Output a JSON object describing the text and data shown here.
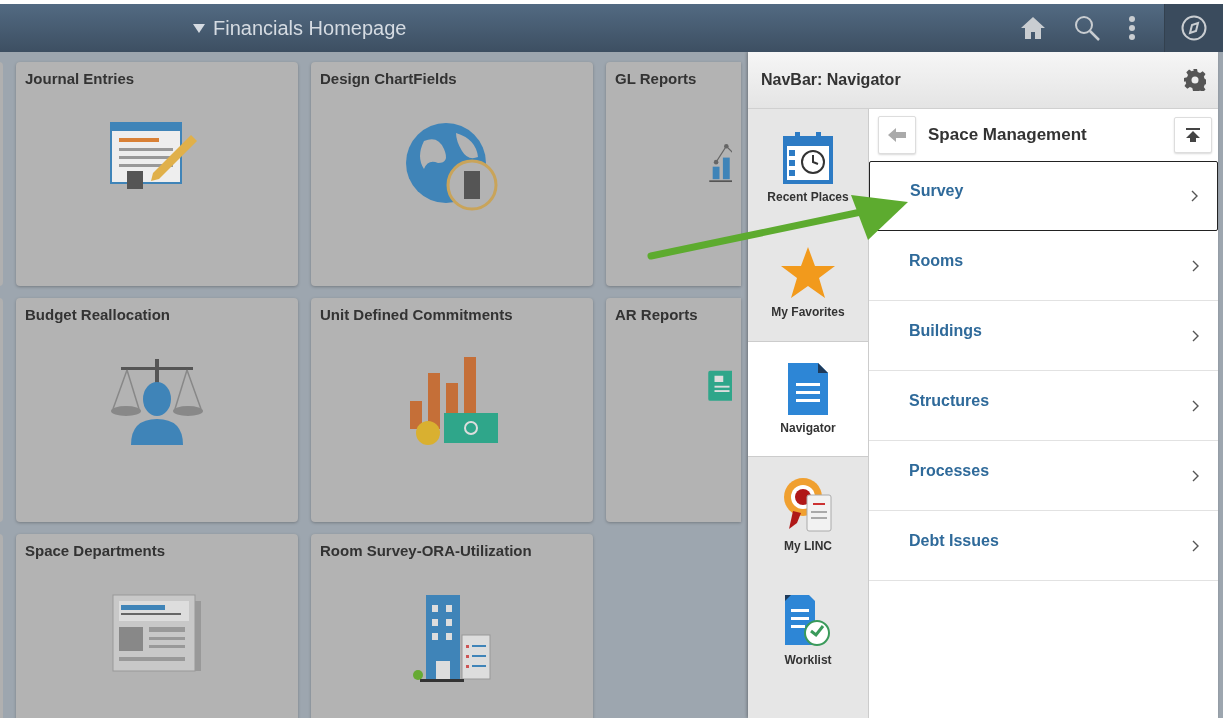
{
  "header": {
    "title": "Financials Homepage"
  },
  "tiles": [
    {
      "title": "Journal Entries",
      "kind": "journal"
    },
    {
      "title": "Design ChartFields",
      "kind": "globe"
    },
    {
      "title": "GL Reports",
      "kind": "chart"
    },
    {
      "title": "Budget Reallocation",
      "kind": "scale"
    },
    {
      "title": "Unit Defined Commitments",
      "kind": "money"
    },
    {
      "title": "AR Reports",
      "kind": "card"
    },
    {
      "title": "Space Departments",
      "kind": "news"
    },
    {
      "title": "Room Survey-ORA-Utilization",
      "kind": "building"
    }
  ],
  "navbar": {
    "title": "NavBar: Navigator",
    "sidebar": [
      {
        "label": "Recent Places",
        "kind": "recent",
        "selected": false
      },
      {
        "label": "My Favorites",
        "kind": "favorites",
        "selected": false
      },
      {
        "label": "Navigator",
        "kind": "navigator",
        "selected": true
      },
      {
        "label": "My LINC",
        "kind": "linc",
        "selected": false
      },
      {
        "label": "Worklist",
        "kind": "worklist",
        "selected": false
      }
    ],
    "folder": "Space Management",
    "items": [
      {
        "label": "Survey",
        "focused": true
      },
      {
        "label": "Rooms",
        "focused": false
      },
      {
        "label": "Buildings",
        "focused": false
      },
      {
        "label": "Structures",
        "focused": false
      },
      {
        "label": "Processes",
        "focused": false
      },
      {
        "label": "Debt Issues",
        "focused": false
      }
    ]
  }
}
